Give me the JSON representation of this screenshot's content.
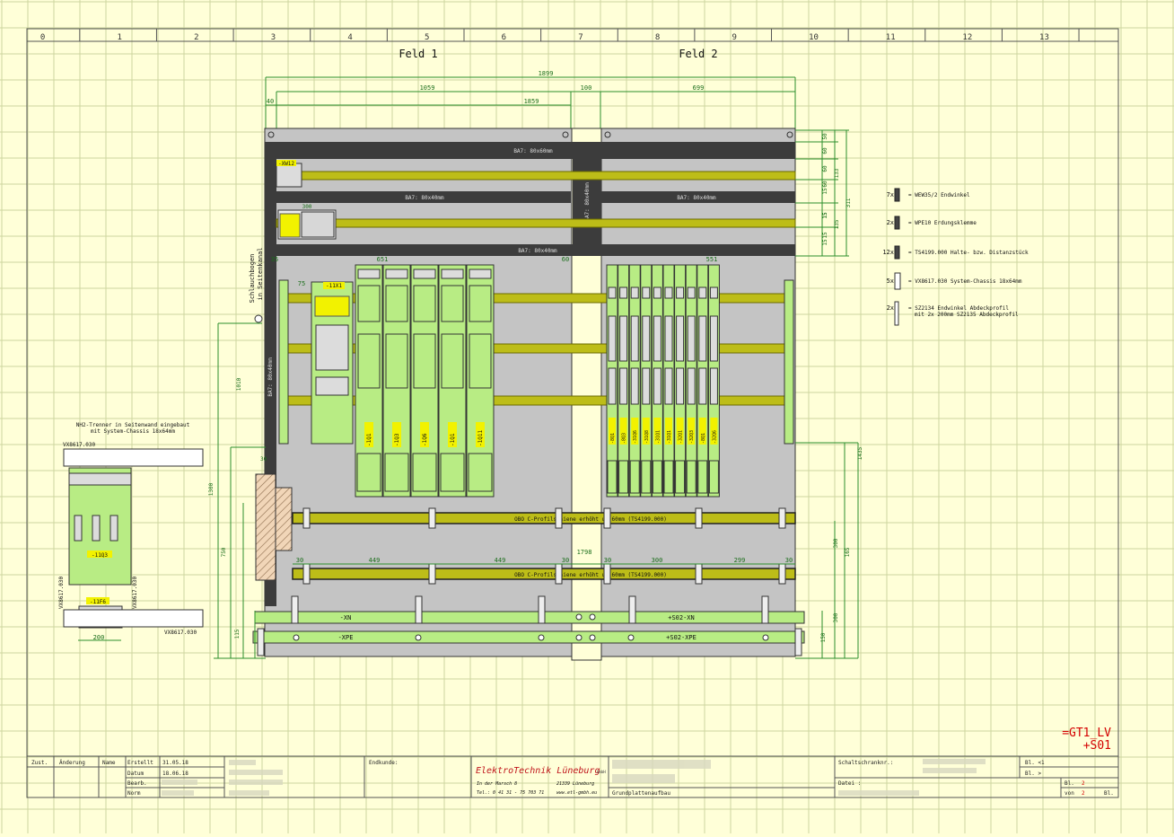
{
  "grid_columns": [
    "0",
    "1",
    "2",
    "3",
    "4",
    "5",
    "6",
    "7",
    "8",
    "9",
    "10",
    "11",
    "12",
    "13"
  ],
  "fields": {
    "feld1": "Feld 1",
    "feld2": "Feld 2"
  },
  "dimensions": {
    "overall_width": "1899",
    "left_width": "1059",
    "gap_width": "100",
    "right_width": "699",
    "left_40": "40",
    "inner_1859": "1859",
    "group_left": "651",
    "group_right": "551",
    "offset_35": "35",
    "offset_75": "75",
    "offset_60": "60",
    "rail_1836": "1836",
    "rail_1798": "1798",
    "rail_segments": [
      "30",
      "449",
      "449",
      "30",
      "30",
      "300",
      "299",
      "30"
    ],
    "right_vertical": [
      "50",
      "60",
      "60",
      "60",
      "15",
      "15",
      "15",
      "15",
      "15",
      "133",
      "311",
      "135"
    ],
    "right_lower": [
      "1435",
      "300",
      "165",
      "300",
      "150"
    ],
    "left_vertical": [
      "1010",
      "1300",
      "750",
      "115"
    ],
    "small_300": "300"
  },
  "labels": {
    "ba7_top": "BA7: 80x60mm",
    "ba7_mid_left": "BA7: 80x40mm",
    "ba7_mid_right": "BA7: 80x40mm",
    "ba7_bottom": "BA7: 80x40mm",
    "ba7_vert_center": "BA7: 80x40mm",
    "ba7_vert_left": "BA7: 80x40mm",
    "side_text_1": "Schlauchbogen",
    "side_text_2": "in Seitenkanal",
    "xw12": "-XW12",
    "x11x1": "-11X1",
    "obo_rail": "OBO C-Profilschiene erhöht um 60mm (TS4199.000)",
    "xn": "-XN",
    "xpe": "-XPE",
    "s02_xn": "+S02-XN",
    "s02_xpe": "+S02-XPE",
    "left_fuses": [
      "-1Q1",
      "-1Q3",
      "-1Q6",
      "-1Q1",
      "-1Q11"
    ],
    "right_fuses": [
      "-8Q1",
      "-8Q3",
      "-31Q6",
      "-31Q8",
      "-31Q1",
      "-31Q1",
      "-32Q1",
      "-32Q3",
      "-8Q1",
      "-32Q6"
    ],
    "nh_title_1": "NH2-Trenner in Seitenwand eingebaut",
    "nh_title_2": "mit System-Chassis 18x64mm",
    "vx_top": "VX8617.030",
    "vx_bottom": "VX8617.030",
    "vx_side_left": "VX8617.030",
    "vx_side_right": "VX8617.030",
    "q_11q3": "-11Q3",
    "f_11f6": "-11F6",
    "dim_200": "200"
  },
  "legend": [
    {
      "qty": "7x",
      "text": "= WEW35/2 Endwinkel"
    },
    {
      "qty": "2x",
      "text": "= WPE10 Erdungsklemme"
    },
    {
      "qty": "12x",
      "text": "= TS4199.000 Halte- bzw. Distanzstück"
    },
    {
      "qty": "5x",
      "text": "= VX8617.030 System-Chassis 18x64mm"
    },
    {
      "qty": "2x",
      "text": "= SZ2134 Endwinkel Abdeckprofil",
      "text2": "mit 2x 200mm SZ2135 Abdeckprofil"
    }
  ],
  "designation": {
    "line1": "=GT1_LV",
    "line2": "+S01"
  },
  "title_block": {
    "h_zust": "Zust.",
    "h_aenderung": "Änderung",
    "h_name": "Name",
    "r_erstellt": "Erstellt",
    "v_erstellt": "31.05.18",
    "r_datum": "Datum",
    "v_datum": "18.06.18",
    "r_bearb": "Bearb.",
    "r_norm": "Norm",
    "endkunde": "Endkunde:",
    "company": "ElektroTechnik Lüneburg",
    "company_suffix": "GmbH",
    "addr1": "In der Marsch 8",
    "addr2": "21339 Lüneburg",
    "tel": "Tel.: 0 41 31 - 75 703 71",
    "web": "www.etl-gmbh.eu",
    "drawing_title": "Grundplattenaufbau",
    "schaltschrank": "Schaltschranknr.:",
    "bl_prev": "Bl. <1",
    "bl_next": "Bl. >",
    "datei": "Datei :",
    "bl_label": "Bl.",
    "bl_value": "2",
    "von_label": "von",
    "von_value": "2",
    "von_suffix": "Bl."
  },
  "colors": {
    "paper": "#ffffd8",
    "grid": "#c9d39a",
    "frame": "#2a2a2a",
    "panel": "#c4c4c4",
    "channel": "#3c3c3c",
    "rail": "#bdbd18",
    "device": "#b8ec84",
    "dim": "#2c8f2c",
    "accent_red": "#d40000",
    "label_yellow": "#f2f200"
  }
}
